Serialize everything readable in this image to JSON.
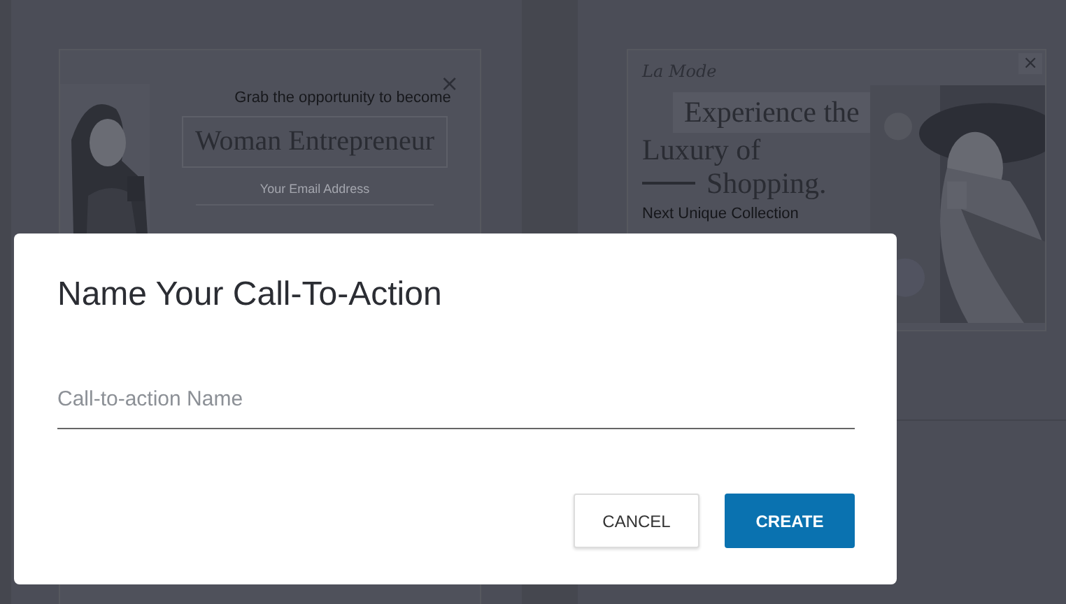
{
  "background_templates": [
    {
      "kind": "optin",
      "close": "×",
      "headline": "Grab the opportunity to become",
      "highlight": "Woman Entrepreneur",
      "email_placeholder": "Your Email Address"
    },
    {
      "kind": "promo",
      "close": "×",
      "brand": "La Mode",
      "headline_lines": [
        "Experience the",
        "Luxury of",
        "Shopping."
      ],
      "subtext": "Next Unique Collection"
    }
  ],
  "dialog": {
    "title": "Name Your Call-To-Action",
    "name_field": {
      "placeholder": "Call-to-action Name"
    },
    "buttons": [
      {
        "label": "CANCEL",
        "kind": "secondary"
      },
      {
        "label": "CREATE",
        "kind": "primary"
      }
    ]
  }
}
